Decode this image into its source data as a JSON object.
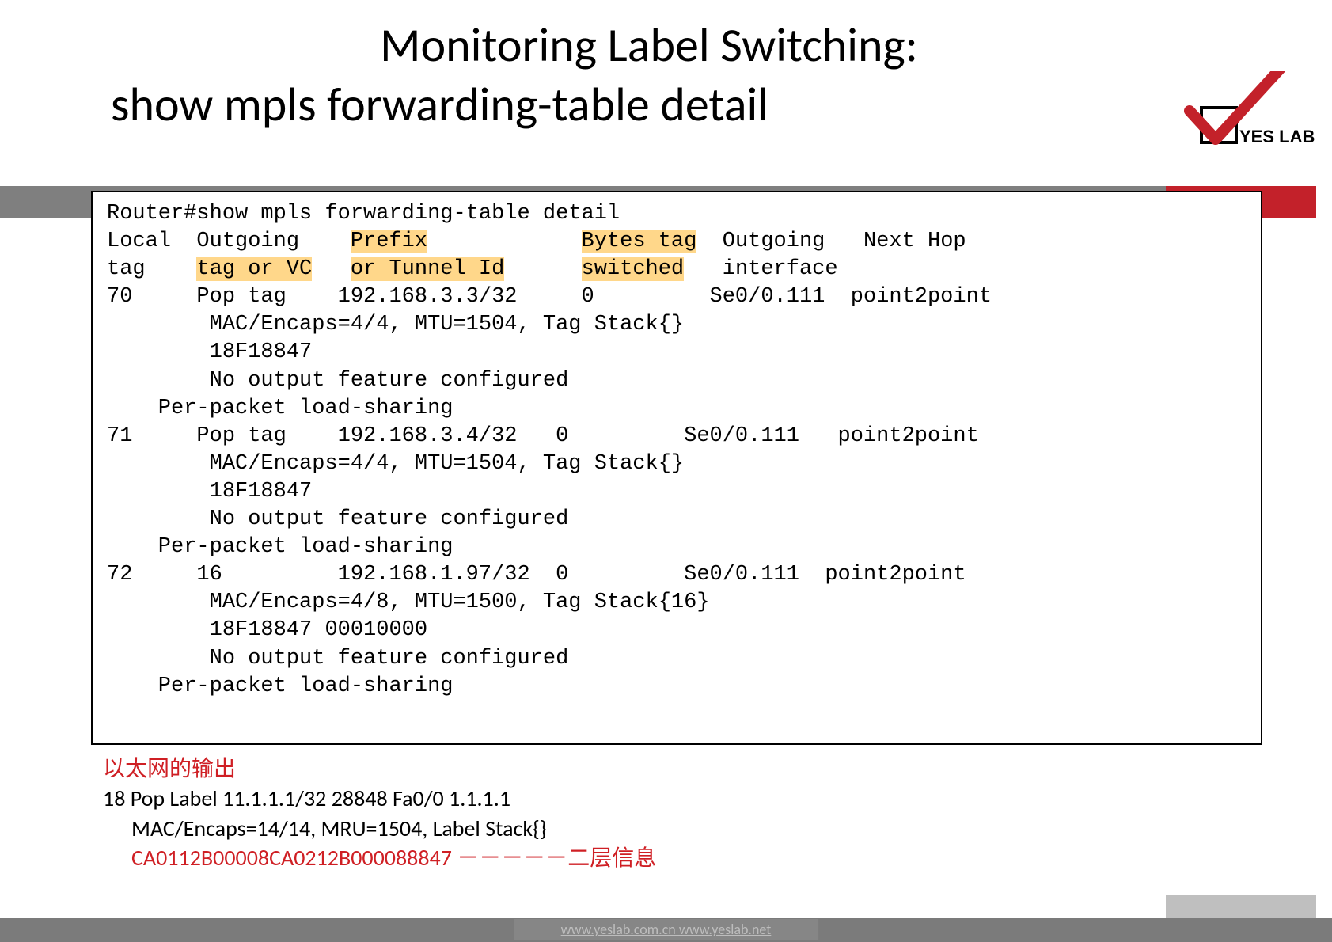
{
  "title": {
    "line1": "Monitoring Label Switching:",
    "line2": "show mpls forwarding-table detail"
  },
  "logo": {
    "text": "YES LAB"
  },
  "terminal": {
    "cmd": "Router#show mpls forwarding-table detail",
    "hdr": {
      "c1a": "Local",
      "c2a": "Outgoing",
      "c3a": "Prefix",
      "c4a": "Bytes tag",
      "c5a": "Outgoing",
      "c6a": "Next Hop",
      "c1b": "tag",
      "c2b": "tag or VC",
      "c3b": "or Tunnel Id",
      "c4b": "switched",
      "c5b": "interface"
    },
    "rows": [
      {
        "l1": "70     Pop tag    192.168.3.3/32     0         Se0/0.111  point2point",
        "l2": "        MAC/Encaps=4/4, MTU=1504, Tag Stack{}",
        "l3": "        18F18847",
        "l4": "        No output feature configured",
        "l5": "    Per-packet load-sharing"
      },
      {
        "l1": "71     Pop tag    192.168.3.4/32   0         Se0/0.111   point2point",
        "l2": "        MAC/Encaps=4/4, MTU=1504, Tag Stack{}",
        "l3": "        18F18847",
        "l4": "        No output feature configured",
        "l5": "    Per-packet load-sharing"
      },
      {
        "l1": "72     16         192.168.1.97/32  0         Se0/0.111  point2point",
        "l2": "        MAC/Encaps=4/8, MTU=1500, Tag Stack{16}",
        "l3": "        18F18847 00010000",
        "l4": "        No output feature configured",
        "l5": "    Per-packet load-sharing"
      }
    ]
  },
  "notes": {
    "red_title": "以太网的输出",
    "row": "18    Pop Label    11.1.1.1/32    28848       Fa0/0    1.1.1.1",
    "enc": "MAC/Encaps=14/14, MRU=1504, Label Stack{}",
    "hex": "CA0112B00008CA0212B000088847 －－－－－二层信息"
  },
  "footer": {
    "text": "www.yeslab.com.cn   www.yeslab.net"
  }
}
